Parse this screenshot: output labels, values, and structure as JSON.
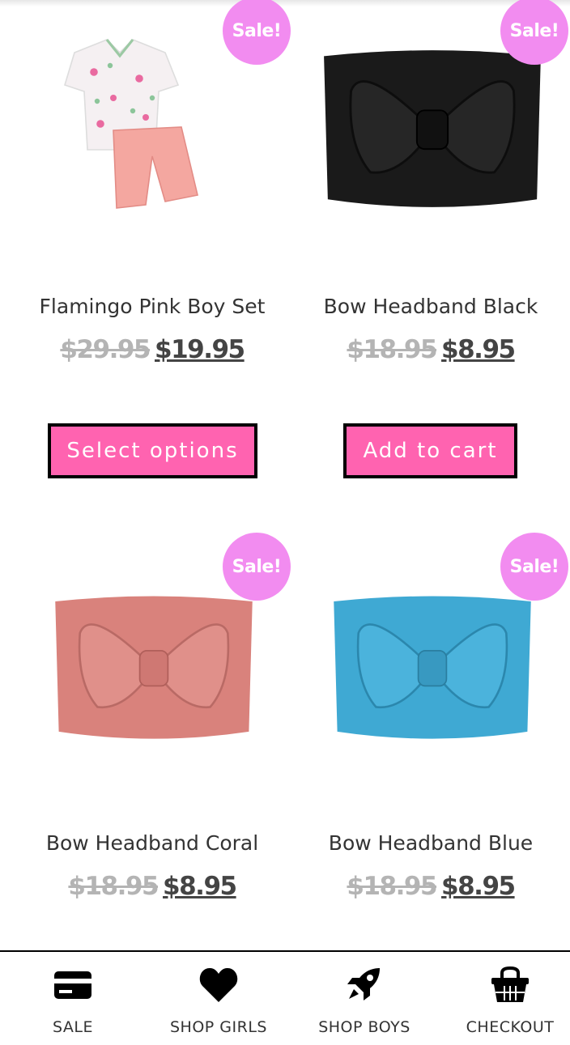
{
  "products": [
    {
      "badge": "Sale!",
      "title": "Flamingo Pink Boy Set",
      "old_price": "$29.95",
      "new_price": "$19.95",
      "button_label": "Select options",
      "image_icon": "flamingo-shirt-shorts-set-image"
    },
    {
      "badge": "Sale!",
      "title": "Bow Headband Black",
      "old_price": "$18.95",
      "new_price": "$8.95",
      "button_label": "Add to cart",
      "image_icon": "black-bow-headband-image",
      "color": "#1a1a1a"
    },
    {
      "badge": "Sale!",
      "title": "Bow Headband Coral",
      "old_price": "$18.95",
      "new_price": "$8.95",
      "image_icon": "coral-bow-headband-image",
      "color": "#d9827c"
    },
    {
      "badge": "Sale!",
      "title": "Bow Headband Blue",
      "old_price": "$18.95",
      "new_price": "$8.95",
      "image_icon": "blue-bow-headband-image",
      "color": "#3fa9d3"
    }
  ],
  "bottom_nav": [
    {
      "label": "SALE",
      "icon": "credit-card-icon"
    },
    {
      "label": "SHOP GIRLS",
      "icon": "heart-icon"
    },
    {
      "label": "SHOP BOYS",
      "icon": "rocket-icon"
    },
    {
      "label": "CHECKOUT",
      "icon": "basket-icon"
    }
  ],
  "colors": {
    "badge": "#f28cf0",
    "button": "#ff63b0",
    "old_price": "#b4b4b4",
    "new_price": "#444444"
  }
}
